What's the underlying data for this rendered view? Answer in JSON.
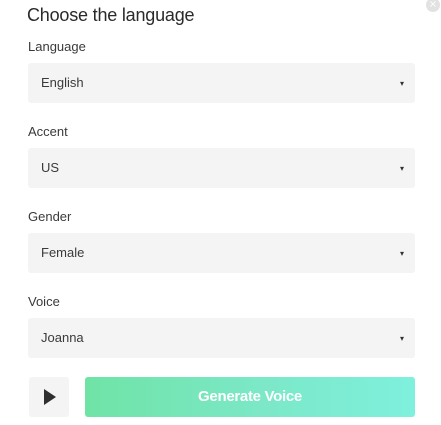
{
  "dialog": {
    "title": "Choose the language",
    "close_icon": "close-icon"
  },
  "fields": [
    {
      "label": "Language",
      "value": "English"
    },
    {
      "label": "Accent",
      "value": "US"
    },
    {
      "label": "Gender",
      "value": "Female"
    },
    {
      "label": "Voice",
      "value": "Joanna"
    }
  ],
  "caret_glyph": "▾",
  "close_glyph": "×",
  "actions": {
    "play_icon": "play-icon",
    "generate_label": "Generate Voice"
  },
  "colors": {
    "generate_gradient_start": "#6fe3a6",
    "generate_gradient_end": "#7ef0dd",
    "field_background": "#f4f4f4"
  }
}
